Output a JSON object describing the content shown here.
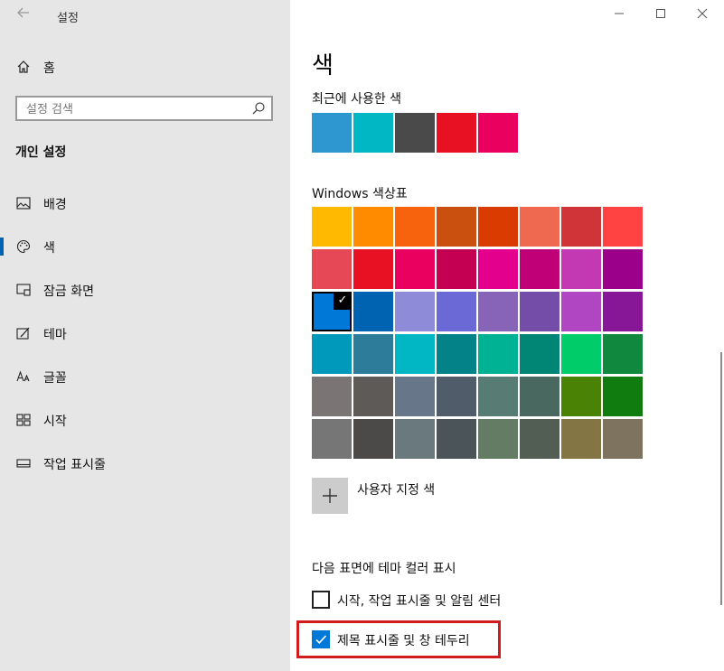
{
  "app": {
    "title": "설정"
  },
  "sidebar": {
    "home_label": "홈",
    "search_placeholder": "설정 검색",
    "section_title": "개인 설정",
    "items": [
      {
        "label": "배경",
        "icon": "image-icon"
      },
      {
        "label": "색",
        "icon": "palette-icon"
      },
      {
        "label": "잠금 화면",
        "icon": "lock-screen-icon"
      },
      {
        "label": "테마",
        "icon": "theme-icon"
      },
      {
        "label": "글꼴",
        "icon": "font-icon"
      },
      {
        "label": "시작",
        "icon": "start-icon"
      },
      {
        "label": "작업 표시줄",
        "icon": "taskbar-icon"
      }
    ],
    "active_item": "색"
  },
  "content": {
    "title": "색",
    "recent_label": "최근에 사용한 색",
    "recent_colors": [
      "#2e97d0",
      "#00b7c3",
      "#4a4a4a",
      "#e81123",
      "#ea005e"
    ],
    "palette_label": "Windows 색상표",
    "palette": [
      [
        "#ffb900",
        "#ff8c00",
        "#f7630c",
        "#ca5010",
        "#da3b01",
        "#ef6950",
        "#d13438",
        "#ff4343"
      ],
      [
        "#e74856",
        "#e81123",
        "#ea005e",
        "#c30052",
        "#e3008c",
        "#bf0077",
        "#c239b3",
        "#9a0089"
      ],
      [
        "#0078d7",
        "#0063b1",
        "#8e8cd8",
        "#6b69d6",
        "#8764b8",
        "#744da9",
        "#b146c2",
        "#881798"
      ],
      [
        "#0099bc",
        "#2d7d9a",
        "#00b7c3",
        "#038387",
        "#00b294",
        "#018574",
        "#00cc6a",
        "#10893e"
      ],
      [
        "#7a7574",
        "#5d5a58",
        "#68768a",
        "#515c6b",
        "#567c73",
        "#486860",
        "#498205",
        "#107c10"
      ],
      [
        "#767676",
        "#4c4a48",
        "#69797e",
        "#4a5459",
        "#647c64",
        "#525e54",
        "#847545",
        "#7e735f"
      ]
    ],
    "selected_swatch": {
      "row": 2,
      "col": 0
    },
    "custom_color_label": "사용자 지정 색",
    "theme_surface_label": "다음 표면에 테마 컬러 표시",
    "checkboxes": [
      {
        "label": "시작, 작업 표시줄 및 알림 센터",
        "checked": false
      },
      {
        "label": "제목 표시줄 및 창 테두리",
        "checked": true
      }
    ]
  },
  "window_controls": {
    "minimize": "minimize-icon",
    "maximize": "maximize-icon",
    "close": "close-icon"
  }
}
